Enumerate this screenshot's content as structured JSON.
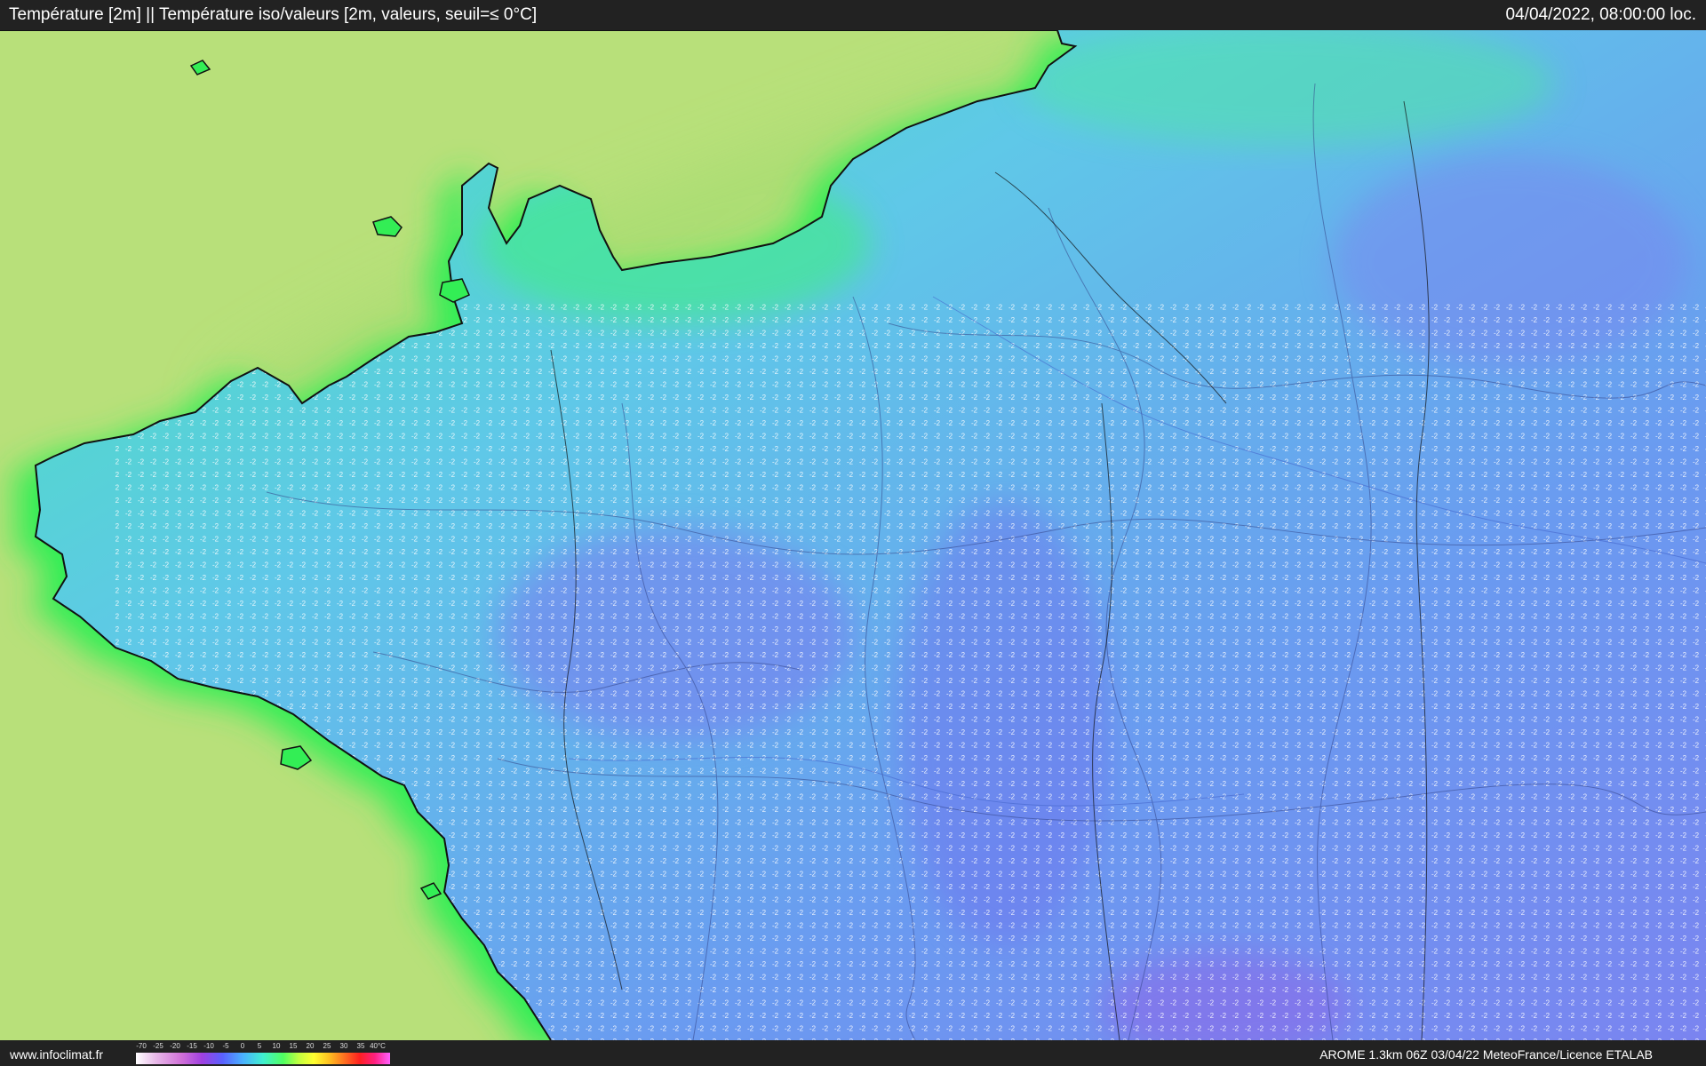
{
  "header": {
    "title": "Température [2m] || Température iso/valeurs [2m, valeurs, seuil=≤ 0°C]",
    "timestamp": "04/04/2022, 08:00:00 loc."
  },
  "footer": {
    "site": "www.infoclimat.fr",
    "credit": "AROME 1.3km 06Z 03/04/22 MeteoFrance/Licence ETALAB"
  },
  "legend": {
    "unit": "°C",
    "ticks": [
      "-70",
      "-25",
      "-20",
      "-15",
      "-10",
      "-5",
      "0",
      "5",
      "10",
      "15",
      "20",
      "25",
      "30",
      "35",
      "40°C"
    ]
  },
  "map": {
    "variable": "Température 2m",
    "threshold": "≤ 0°C",
    "colors": {
      "sea": "#b8e07a",
      "coastal_band": "#33ee55",
      "land_mild": "#55f0c0",
      "land_cold": "#6a9af0",
      "land_colder": "#7a7af0",
      "value_text": "#ffffff",
      "borders": "#111111"
    }
  }
}
